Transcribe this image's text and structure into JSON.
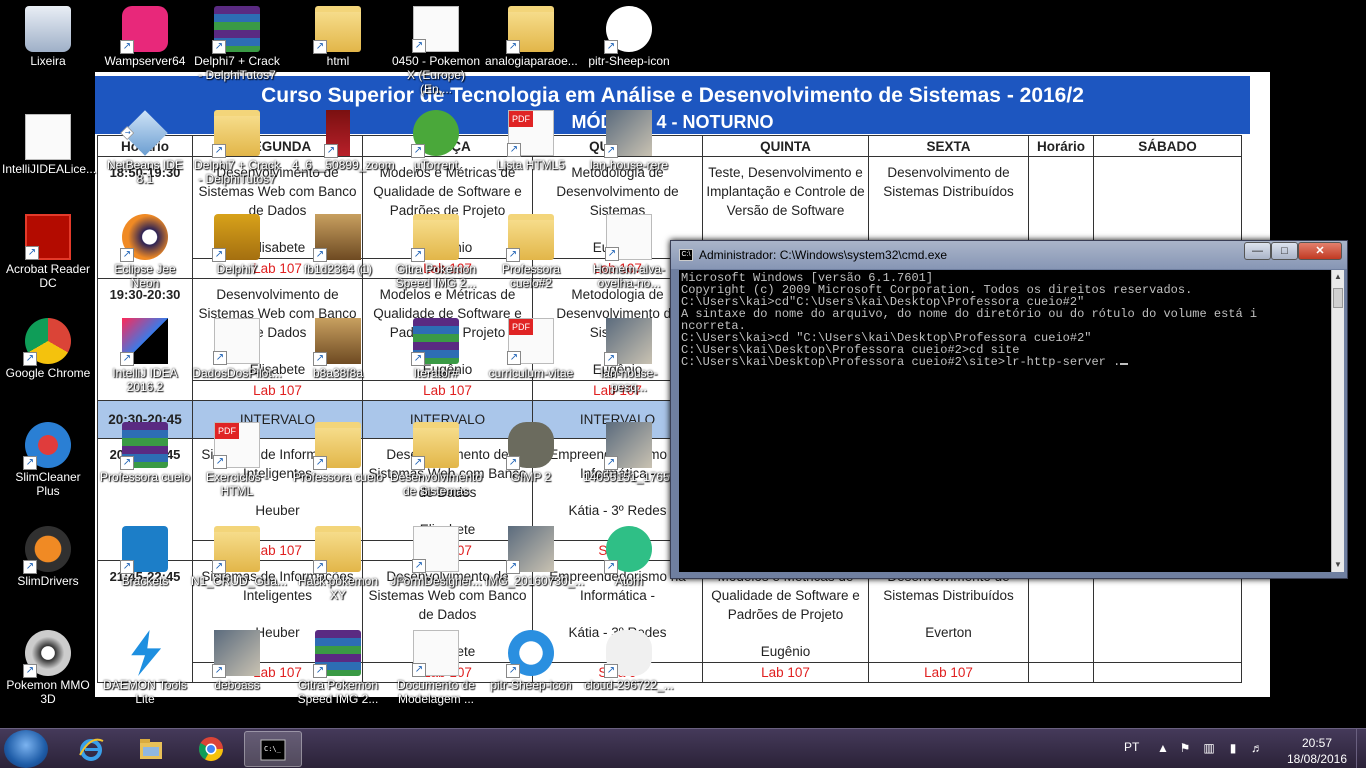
{
  "wallpaper": {
    "title": "Curso Superior de Tecnologia em Análise e Desenvolvimento de Sistemas - 2016/2",
    "subtitle": "MÓDULO 4 - NOTURNO",
    "headers": [
      "Horário",
      "SEGUNDA",
      "TERÇA",
      "QUARTA",
      "QUINTA",
      "SEXTA",
      "Horário",
      "SÁBADO"
    ],
    "rows": [
      {
        "time": "18:50-19:30",
        "cells": [
          {
            "subj": "Desenvolvimento de Sistemas Web com Banco de Dados",
            "teacher": "Elisabete",
            "room": "Lab 107"
          },
          {
            "subj": "Modelos e Métricas de Qualidade de Software e Padrões de Projeto",
            "teacher": "Eugênio",
            "room": "Lab 107"
          },
          {
            "subj": "Metodologia de Desenvolvimento de Sistemas",
            "teacher": "Eugênio",
            "room": "Lab 107"
          },
          {
            "subj": "Teste, Desenvolvimento e Implantação e Controle de Versão de Software",
            "teacher": "",
            "room": ""
          },
          {
            "subj": "Desenvolvimento de Sistemas Distribuídos",
            "teacher": "",
            "room": ""
          }
        ]
      },
      {
        "time": "19:30-20:30",
        "cells": [
          {
            "subj": "Desenvolvimento de Sistemas Web com Banco de Dados",
            "teacher": "Elisabete",
            "room": "Lab 107"
          },
          {
            "subj": "Modelos e Métricas de Qualidade de Software e Padrões de Projeto",
            "teacher": "Eugênio",
            "room": "Lab 107"
          },
          {
            "subj": "Metodologia de Desenvolvimento de Sistemas",
            "teacher": "Eugênio",
            "room": "Lab 107"
          },
          {
            "subj": "",
            "teacher": "",
            "room": ""
          },
          {
            "subj": "",
            "teacher": "",
            "room": ""
          }
        ]
      },
      {
        "time": "20:45-21:45",
        "cells": [
          {
            "subj": "Sistemas de Informações Inteligentes",
            "teacher": "Heuber",
            "room": "Lab 107"
          },
          {
            "subj": "Desenvolvimento de Sistemas Web com Banco de Dados",
            "teacher": "Elisabete",
            "room": "Lab 107"
          },
          {
            "subj": "Empreendedorismo na Informática -",
            "teacher": "Kátia - 3º Redes",
            "room": "Sala 9"
          },
          {
            "subj": "",
            "teacher": "",
            "room": ""
          },
          {
            "subj": "",
            "teacher": "",
            "room": ""
          }
        ]
      },
      {
        "time": "21:45-22:45",
        "cells": [
          {
            "subj": "Sistemas de Informações Inteligentes",
            "teacher": "Heuber",
            "room": "Lab 107"
          },
          {
            "subj": "Desenvolvimento de Sistemas Web com Banco de Dados",
            "teacher": "Elisabete",
            "room": "Lab 107"
          },
          {
            "subj": "Empreendedorismo na Informática -",
            "teacher": "Kátia - 3º Redes",
            "room": "Sala 9"
          },
          {
            "subj": "Modelos e Métricas de Qualidade de Software e Padrões de Projeto",
            "teacher": "Eugênio",
            "room": "Lab 107"
          },
          {
            "subj": "Desenvolvimento de Sistemas Distribuídos",
            "teacher": "Everton",
            "room": "Lab 107"
          }
        ]
      }
    ],
    "interval_time": "20:30-20:45",
    "interval_label": "INTERVALO"
  },
  "icons": [
    {
      "label": "Lixeira",
      "icon": "recycle-bin-icon"
    },
    {
      "label": "Wampserver64",
      "icon": "wampserver-icon"
    },
    {
      "label": "Delphi7 + Crack - DelphiTutos7",
      "icon": "winrar-icon"
    },
    {
      "label": "html",
      "icon": "folder-chrome-icon"
    },
    {
      "label": "0450 - Pokemon X (Europe) (En,...",
      "icon": "torrent-file-icon"
    },
    {
      "label": "analogiaparaoe...",
      "icon": "folder-icon"
    },
    {
      "label": "pitr-Sheep-icon",
      "icon": "sheep-icon"
    },
    {
      "label": "IntelliJIDEALice...",
      "icon": "document-icon"
    },
    {
      "label": "NetBeans IDE 8.1",
      "icon": "netbeans-icon"
    },
    {
      "label": "Delphi7 + Crack - DelphiTutos7",
      "icon": "folder-icon"
    },
    {
      "label": "4_6__50899_zoom",
      "icon": "bottle-image-icon"
    },
    {
      "label": "µTorrent",
      "icon": "utorrent-icon"
    },
    {
      "label": "Lista HTML5",
      "icon": "pdf-icon"
    },
    {
      "label": "lan-house-rere",
      "icon": "photo-icon"
    },
    {
      "label": "Acrobat Reader DC",
      "icon": "acrobat-icon"
    },
    {
      "label": "Eclipse Jee Neon",
      "icon": "eclipse-icon"
    },
    {
      "label": "Delphi7",
      "icon": "delphi-icon"
    },
    {
      "label": "fb1d2364 (1)",
      "icon": "card-image-icon"
    },
    {
      "label": "Gitra Pokemon Speed IMG 2...",
      "icon": "folder-icon"
    },
    {
      "label": "Professora cueio#2",
      "icon": "folder-icon"
    },
    {
      "label": "Homem-alva-ovelha-no...",
      "icon": "audio-file-icon"
    },
    {
      "label": "Google Chrome",
      "icon": "chrome-icon"
    },
    {
      "label": "IntelliJ IDEA 2016.2",
      "icon": "intellij-icon"
    },
    {
      "label": "DadosDosPilot...",
      "icon": "document-icon"
    },
    {
      "label": "b8a38f8a",
      "icon": "card-image-icon"
    },
    {
      "label": "Iterator#",
      "icon": "winrar-icon"
    },
    {
      "label": "curriculum-vitae",
      "icon": "pdf-icon"
    },
    {
      "label": "lan-house-pesq...",
      "icon": "photo-icon"
    },
    {
      "label": "SlimCleaner Plus",
      "icon": "slimcleaner-icon"
    },
    {
      "label": "Professora cueio",
      "icon": "winrar-icon"
    },
    {
      "label": "Exercicios - HTML",
      "icon": "pdf-icon"
    },
    {
      "label": "Professora cueio",
      "icon": "folder-icon"
    },
    {
      "label": "Desenvolvimento de Sistemas",
      "icon": "folder-icon"
    },
    {
      "label": "GIMP 2",
      "icon": "gimp-icon"
    },
    {
      "label": "14055151_1765...",
      "icon": "photo-icon"
    },
    {
      "label": "SlimDrivers",
      "icon": "slimdrivers-icon"
    },
    {
      "label": "Brackets",
      "icon": "brackets-icon"
    },
    {
      "label": "N1_CRUD_Gua...",
      "icon": "folder-icon"
    },
    {
      "label": "Hack pokemon XY",
      "icon": "folder-icon"
    },
    {
      "label": "JFormDesigner...",
      "icon": "document-icon"
    },
    {
      "label": "IMG_20160730_...",
      "icon": "photo-icon"
    },
    {
      "label": "Atom",
      "icon": "atom-icon"
    },
    {
      "label": "Pokemon MMO 3D",
      "icon": "pokemon-mmo-icon"
    },
    {
      "label": "DAEMON Tools Lite",
      "icon": "daemon-tools-icon"
    },
    {
      "label": "deboass",
      "icon": "photo-icon"
    },
    {
      "label": "Gitra Pokemon Speed IMG 2...",
      "icon": "winrar-icon"
    },
    {
      "label": "Documento de Modelagem ...",
      "icon": "document-icon"
    },
    {
      "label": "pitr-Sheep-icon",
      "icon": "ie-icon"
    },
    {
      "label": "cloud-296722_...",
      "icon": "cloud-image-icon"
    }
  ],
  "cmd": {
    "title": "Administrador: C:\\Windows\\system32\\cmd.exe",
    "lines": [
      "Microsoft Windows [versão 6.1.7601]",
      "Copyright (c) 2009 Microsoft Corporation. Todos os direitos reservados.",
      "",
      "C:\\Users\\kai>cd\"C:\\Users\\kai\\Desktop\\Professora cueio#2\"",
      "A sintaxe do nome do arquivo, do nome do diretório ou do rótulo do volume está i",
      "ncorreta.",
      "",
      "C:\\Users\\kai>cd \"C:\\Users\\kai\\Desktop\\Professora cueio#2\"",
      "",
      "C:\\Users\\kai\\Desktop\\Professora cueio#2>cd site",
      "",
      "C:\\Users\\kai\\Desktop\\Professora cueio#2\\site>lr-http-server ."
    ]
  },
  "taskbar": {
    "apps": [
      "internet-explorer-icon",
      "file-explorer-icon",
      "chrome-icon",
      "cmd-icon"
    ],
    "language": "PT",
    "time": "20:57",
    "date": "18/08/2016"
  }
}
